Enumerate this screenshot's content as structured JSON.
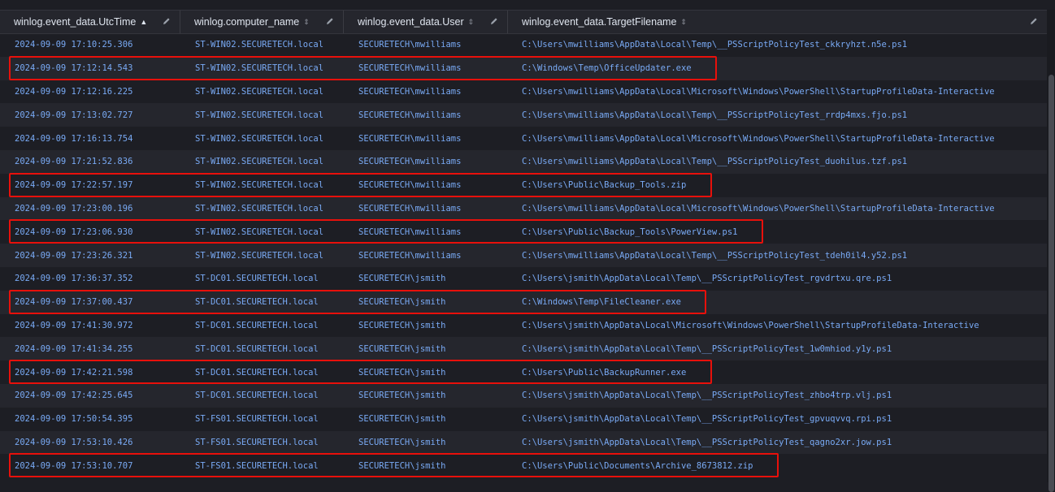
{
  "columns": [
    {
      "label": "winlog.event_data.UtcTime",
      "sort": "▲",
      "sort_active": true
    },
    {
      "label": "winlog.computer_name",
      "sort": "⇕",
      "sort_active": false
    },
    {
      "label": "winlog.event_data.User",
      "sort": "⇕",
      "sort_active": false
    },
    {
      "label": "winlog.event_data.TargetFilename",
      "sort": "⇕",
      "sort_active": false
    }
  ],
  "rows": [
    {
      "time": "2024-09-09 17:10:25.306",
      "computer": "ST-WIN02.SECURETECH.local",
      "user": "SECURETECH\\mwilliams",
      "file": "C:\\Users\\mwilliams\\AppData\\Local\\Temp\\__PSScriptPolicyTest_ckkryhzt.n5e.ps1",
      "highlight": false
    },
    {
      "time": "2024-09-09 17:12:14.543",
      "computer": "ST-WIN02.SECURETECH.local",
      "user": "SECURETECH\\mwilliams",
      "file": "C:\\Windows\\Temp\\OfficeUpdater.exe",
      "highlight": true
    },
    {
      "time": "2024-09-09 17:12:16.225",
      "computer": "ST-WIN02.SECURETECH.local",
      "user": "SECURETECH\\mwilliams",
      "file": "C:\\Users\\mwilliams\\AppData\\Local\\Microsoft\\Windows\\PowerShell\\StartupProfileData-Interactive",
      "highlight": false
    },
    {
      "time": "2024-09-09 17:13:02.727",
      "computer": "ST-WIN02.SECURETECH.local",
      "user": "SECURETECH\\mwilliams",
      "file": "C:\\Users\\mwilliams\\AppData\\Local\\Temp\\__PSScriptPolicyTest_rrdp4mxs.fjo.ps1",
      "highlight": false
    },
    {
      "time": "2024-09-09 17:16:13.754",
      "computer": "ST-WIN02.SECURETECH.local",
      "user": "SECURETECH\\mwilliams",
      "file": "C:\\Users\\mwilliams\\AppData\\Local\\Microsoft\\Windows\\PowerShell\\StartupProfileData-Interactive",
      "highlight": false
    },
    {
      "time": "2024-09-09 17:21:52.836",
      "computer": "ST-WIN02.SECURETECH.local",
      "user": "SECURETECH\\mwilliams",
      "file": "C:\\Users\\mwilliams\\AppData\\Local\\Temp\\__PSScriptPolicyTest_duohilus.tzf.ps1",
      "highlight": false
    },
    {
      "time": "2024-09-09 17:22:57.197",
      "computer": "ST-WIN02.SECURETECH.local",
      "user": "SECURETECH\\mwilliams",
      "file": "C:\\Users\\Public\\Backup_Tools.zip",
      "highlight": true
    },
    {
      "time": "2024-09-09 17:23:00.196",
      "computer": "ST-WIN02.SECURETECH.local",
      "user": "SECURETECH\\mwilliams",
      "file": "C:\\Users\\mwilliams\\AppData\\Local\\Microsoft\\Windows\\PowerShell\\StartupProfileData-Interactive",
      "highlight": false
    },
    {
      "time": "2024-09-09 17:23:06.930",
      "computer": "ST-WIN02.SECURETECH.local",
      "user": "SECURETECH\\mwilliams",
      "file": "C:\\Users\\Public\\Backup_Tools\\PowerView.ps1",
      "highlight": true
    },
    {
      "time": "2024-09-09 17:23:26.321",
      "computer": "ST-WIN02.SECURETECH.local",
      "user": "SECURETECH\\mwilliams",
      "file": "C:\\Users\\mwilliams\\AppData\\Local\\Temp\\__PSScriptPolicyTest_tdeh0il4.y52.ps1",
      "highlight": false
    },
    {
      "time": "2024-09-09 17:36:37.352",
      "computer": "ST-DC01.SECURETECH.local",
      "user": "SECURETECH\\jsmith",
      "file": "C:\\Users\\jsmith\\AppData\\Local\\Temp\\__PSScriptPolicyTest_rgvdrtxu.qre.ps1",
      "highlight": false
    },
    {
      "time": "2024-09-09 17:37:00.437",
      "computer": "ST-DC01.SECURETECH.local",
      "user": "SECURETECH\\jsmith",
      "file": "C:\\Windows\\Temp\\FileCleaner.exe",
      "highlight": true
    },
    {
      "time": "2024-09-09 17:41:30.972",
      "computer": "ST-DC01.SECURETECH.local",
      "user": "SECURETECH\\jsmith",
      "file": "C:\\Users\\jsmith\\AppData\\Local\\Microsoft\\Windows\\PowerShell\\StartupProfileData-Interactive",
      "highlight": false
    },
    {
      "time": "2024-09-09 17:41:34.255",
      "computer": "ST-DC01.SECURETECH.local",
      "user": "SECURETECH\\jsmith",
      "file": "C:\\Users\\jsmith\\AppData\\Local\\Temp\\__PSScriptPolicyTest_1w0mhiod.y1y.ps1",
      "highlight": false
    },
    {
      "time": "2024-09-09 17:42:21.598",
      "computer": "ST-DC01.SECURETECH.local",
      "user": "SECURETECH\\jsmith",
      "file": "C:\\Users\\Public\\BackupRunner.exe",
      "highlight": true
    },
    {
      "time": "2024-09-09 17:42:25.645",
      "computer": "ST-DC01.SECURETECH.local",
      "user": "SECURETECH\\jsmith",
      "file": "C:\\Users\\jsmith\\AppData\\Local\\Temp\\__PSScriptPolicyTest_zhbo4trp.vlj.ps1",
      "highlight": false
    },
    {
      "time": "2024-09-09 17:50:54.395",
      "computer": "ST-FS01.SECURETECH.local",
      "user": "SECURETECH\\jsmith",
      "file": "C:\\Users\\jsmith\\AppData\\Local\\Temp\\__PSScriptPolicyTest_gpvuqvvq.rpi.ps1",
      "highlight": false
    },
    {
      "time": "2024-09-09 17:53:10.426",
      "computer": "ST-FS01.SECURETECH.local",
      "user": "SECURETECH\\jsmith",
      "file": "C:\\Users\\jsmith\\AppData\\Local\\Temp\\__PSScriptPolicyTest_qagno2xr.jow.ps1",
      "highlight": false
    },
    {
      "time": "2024-09-09 17:53:10.707",
      "computer": "ST-FS01.SECURETECH.local",
      "user": "SECURETECH\\jsmith",
      "file": "C:\\Users\\Public\\Documents\\Archive_8673812.zip",
      "highlight": true
    }
  ],
  "colors": {
    "highlight": "#e8100b",
    "link": "#79aaf5",
    "background": "#1d1e24",
    "alt_row": "#25262d"
  }
}
